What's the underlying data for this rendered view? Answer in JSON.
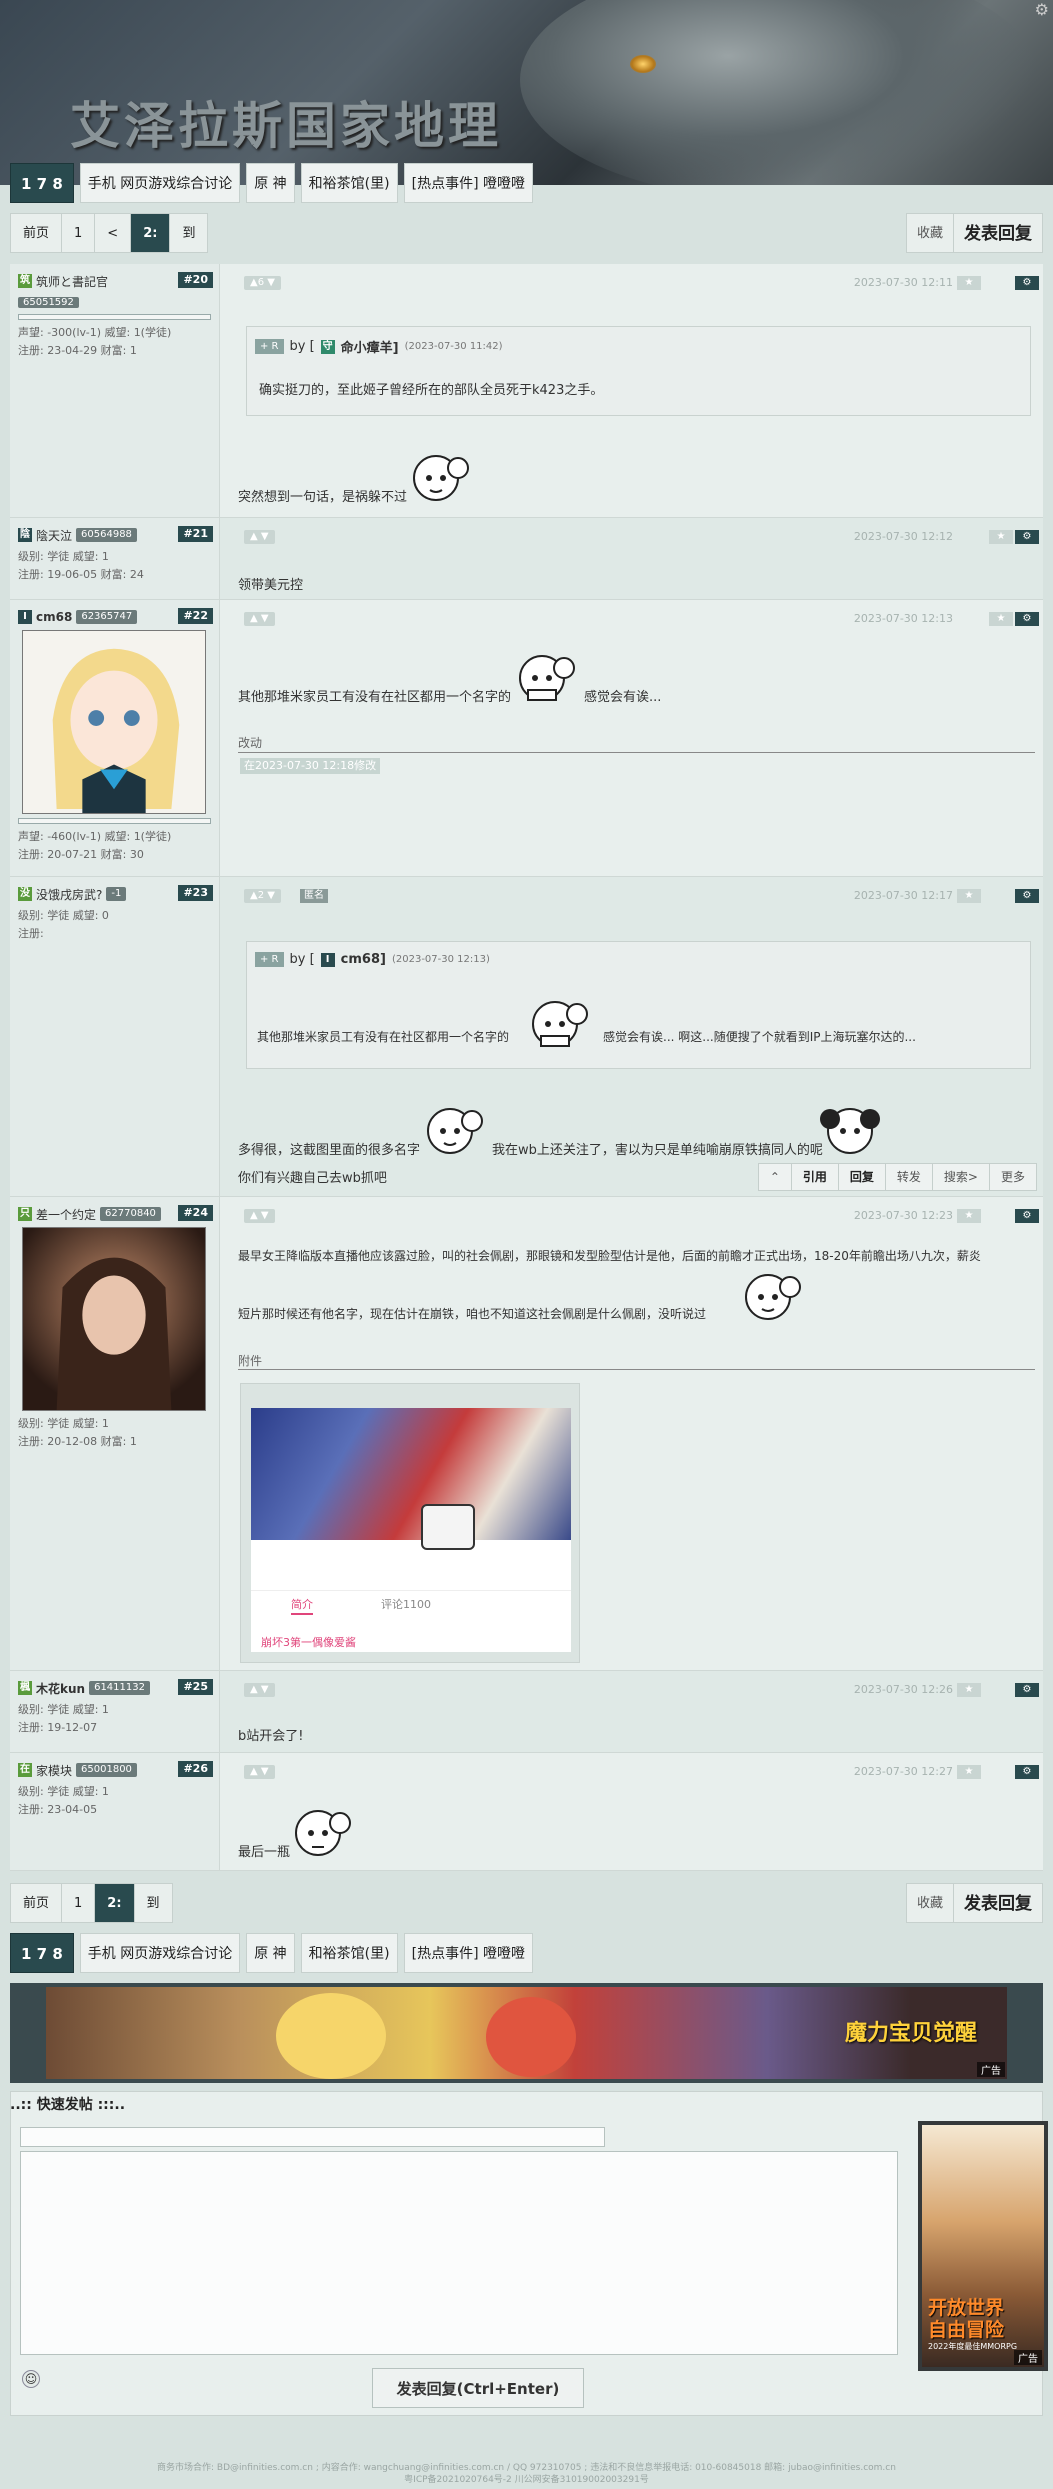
{
  "header": {
    "site_title": "艾泽拉斯国家地理",
    "settings_icon": "gear-icon"
  },
  "breadcrumbs": {
    "home": "1 7 8",
    "items": [
      "手机 网页游戏综合讨论",
      "原 神",
      "和裕茶馆(里)",
      "[热点事件] 噔噔噔"
    ]
  },
  "pager": {
    "items": [
      "前页",
      "1",
      "<",
      "2:",
      "到"
    ],
    "current": "2:",
    "bottom_items": [
      "前页",
      "1",
      "2:",
      "到"
    ]
  },
  "actions": {
    "collect": "收藏",
    "reply": "发表回复"
  },
  "posts": [
    {
      "user": "筑师と書記官",
      "uid": "65051592",
      "floor": "#20",
      "votes": "▲6 ▼",
      "time": "2023-07-30 12:11",
      "stats": [
        "声望: -300(lv-1)  威望: 1(学徒)",
        "注册: 23-04-29  财富: 1"
      ],
      "quote_tag": "+ R",
      "quote_by": "by [",
      "quote_user": "命小瘴羊]",
      "quote_time": "(2023-07-30 11:42)",
      "quote_text": "确实挺刀的，至此姬子曾经所在的部队全员死于k423之手。",
      "text": "突然想到一句话，是祸躲不过"
    },
    {
      "user": "陰天泣",
      "uid": "60564988",
      "floor": "#21",
      "time": "2023-07-30 12:12",
      "stats": [
        "级别: 学徒      威望: 1",
        "注册: 19-06-05  财富: 24"
      ],
      "text": "领带美元控"
    },
    {
      "user": "cm68",
      "uid": "62365747",
      "floor": "#22",
      "time": "2023-07-30 12:13",
      "stats": [
        "声望: -460(lv-1)  威望: 1(学徒)",
        "注册: 20-07-21  财富: 30"
      ],
      "text_a": "其他那堆米家员工有没有在社区都用一个名字的",
      "text_b": "感觉会有诶...",
      "edit_label": "改动",
      "edit_stamp": "在2023-07-30 12:18修改"
    },
    {
      "user": "没饿戌房武?",
      "uid": "-1",
      "floor": "#23",
      "votes": "▲2 ▼",
      "anon": "匿名",
      "time": "2023-07-30 12:17",
      "stats": [
        "级别: 学徒      威望: 0",
        "注册:"
      ],
      "quote_tag": "+ R",
      "quote_by": "by [",
      "quote_user": "cm68]",
      "quote_time": "(2023-07-30 12:13)",
      "quote_text_a": "其他那堆米家员工有没有在社区都用一个名字的",
      "quote_text_b": "感觉会有诶... 啊这...随便搜了个就看到IP上海玩塞尔达的...",
      "text_a": "多得很，这截图里面的很多名字",
      "text_b": "我在wb上还关注了，害以为只是单纯喻崩原铁搞同人的呢",
      "text_c": "你们有兴趣自己去wb抓吧",
      "ops": [
        "⌃",
        "引用",
        "回复",
        "转发",
        "搜索>",
        "更多"
      ]
    },
    {
      "user": "差一个约定",
      "uid": "62770840",
      "floor": "#24",
      "time": "2023-07-30 12:23",
      "stats": [
        "级别: 学徒      威望: 1",
        "注册: 20-12-08  财富: 1"
      ],
      "text_a": "最早女王降临版本直播他应该露过脸，叫的社会佩剧，那眼镜和发型脸型估计是他，后面的前瞻才正式出场，18-20年前瞻出场八九次，薪炎",
      "text_b": "短片那时候还有他名字，现在估计在崩铁，咱也不知道这社会佩剧是什么佩剧，没听说过",
      "attach_label": "附件",
      "attach_tabs": [
        "简介",
        "评论1100"
      ],
      "attach_caption": "崩坏3第一偶像爱酱"
    },
    {
      "user": "木花kun",
      "uid": "61411132",
      "floor": "#25",
      "time": "2023-07-30 12:26",
      "stats": [
        "级别: 学徒      威望: 1",
        "注册: 19-12-07"
      ],
      "text": "b站开会了!"
    },
    {
      "user": "家模块",
      "uid": "65001800",
      "floor": "#26",
      "time": "2023-07-30 12:27",
      "stats": [
        "级别: 学徒      威望: 1",
        "注册: 23-04-05"
      ],
      "text": "最后一瓶"
    }
  ],
  "ad": {
    "banner_text": "魔力宝贝觉醒",
    "tag": "广告",
    "side_text_a": "开放世界",
    "side_text_b": "自由冒险",
    "side_text_c": "2022年度最佳MMORPG"
  },
  "quick_post": {
    "title": "..:: 快速发帖 :::..",
    "submit": "发表回复(Ctrl+Enter)",
    "emoji_icon": "smile-icon"
  },
  "footer": {
    "line1": "商务市场合作: BD@infinities.com.cn ; 内容合作: wangchuang@infinities.com.cn / QQ 972310705 ; 违法和不良信息举报电话: 010-60845018 邮箱: jubao@infinities.com.cn",
    "line2": "粤ICP备2021020764号-2 川公网安备31019002003291号"
  }
}
